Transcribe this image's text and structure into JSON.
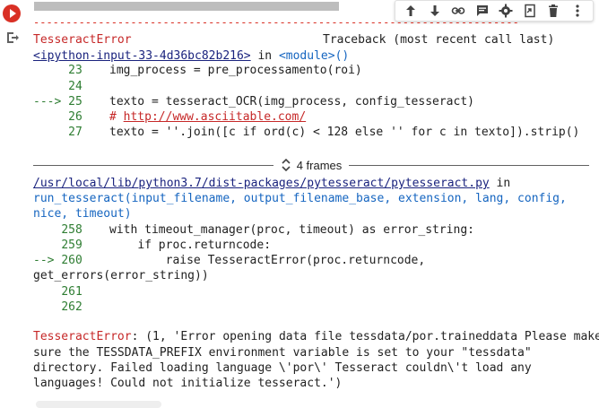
{
  "gutter": {
    "run_icon": "run-error-icon",
    "output_icon": "output-redirect-icon"
  },
  "toolbar": {
    "buttons": [
      "arrow-up-icon",
      "arrow-down-icon",
      "link-icon",
      "comment-icon",
      "gear-icon",
      "mirror-cell-icon",
      "delete-icon",
      "more-vert-icon"
    ]
  },
  "traceback": {
    "error_name": "TesseractError",
    "header_right": "Traceback (most recent call last)",
    "frame1_link": "<ipython-input-33-4d36bc82b216>",
    "frame1_in": " in ",
    "frame1_module": "<module>()",
    "frame1_lines": [
      {
        "num": "23",
        "prefix": "",
        "code": "img_process = pre_processamento(roi)"
      },
      {
        "num": "24",
        "prefix": "",
        "code": ""
      },
      {
        "num": "25",
        "prefix": "--->",
        "code": "texto = tesseract_OCR(img_process, config_tesseract)"
      },
      {
        "num": "26",
        "prefix": "",
        "code_comment": "# ",
        "code_link": "http://www.asciitable.com/"
      },
      {
        "num": "27",
        "prefix": "",
        "code": "texto = ''.join([c if ord(c) < 128 else '' for c in texto]).strip()"
      }
    ],
    "frames_label": "4 frames",
    "frame2_link": "/usr/local/lib/python3.7/dist-packages/pytesseract/pytesseract.py",
    "frame2_in": " in",
    "frame2_func_1": "run_tesseract(input_filename, output_filename_base, extension, lang, config,",
    "frame2_func_2": "nice, timeout)",
    "frame2_lines": [
      {
        "num": "258",
        "code": "with timeout_manager(proc, timeout) as error_string:"
      },
      {
        "num": "259",
        "code": "if proc.returncode:"
      },
      {
        "num": "260",
        "prefix": "-->",
        "code": "raise TesseractError(proc.returncode,"
      },
      {
        "num": "",
        "code": "get_errors(error_string))"
      },
      {
        "num": "261",
        "code": ""
      },
      {
        "num": "262",
        "code": ""
      }
    ],
    "error_message": [
      "TesseractError: (1, 'Error opening data file tessdata/por.traineddata Please make",
      "sure the TESSDATA_PREFIX environment variable is set to your \"tessdata\"",
      "directory. Failed loading language \\'por\\' Tesseract couldn\\'t load any",
      "languages! Could not initialize tesseract.')"
    ]
  }
}
